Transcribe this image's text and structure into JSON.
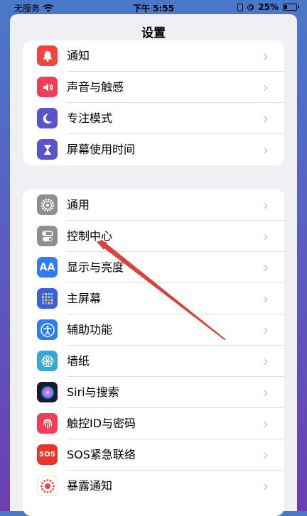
{
  "statusbar": {
    "carrier": "无服务",
    "time": "下午 5:55",
    "battery": "25%",
    "battery_level": 0.25
  },
  "page": {
    "title": "设置"
  },
  "group1": [
    {
      "label": "通知",
      "icon": "notification-bell-icon",
      "color": "#f0443f"
    },
    {
      "label": "声音与触感",
      "icon": "speaker-icon",
      "color": "#f03e5a"
    },
    {
      "label": "专注模式",
      "icon": "moon-icon",
      "color": "#5a54c9"
    },
    {
      "label": "屏幕使用时间",
      "icon": "hourglass-icon",
      "color": "#5a54c9"
    }
  ],
  "group2": [
    {
      "label": "通用",
      "icon": "gear-icon",
      "color": "#8e8e93"
    },
    {
      "label": "控制中心",
      "icon": "toggle-switches-icon",
      "color": "#8e8e93"
    },
    {
      "label": "显示与亮度",
      "icon": "aa-text-icon",
      "color": "#2f7cf6"
    },
    {
      "label": "主屏幕",
      "icon": "app-grid-icon",
      "color": "#3a5fd8"
    },
    {
      "label": "辅助功能",
      "icon": "accessibility-icon",
      "color": "#2f7cf6"
    },
    {
      "label": "墙纸",
      "icon": "flower-icon",
      "color": "#37a7d6"
    },
    {
      "label": "Siri与搜索",
      "icon": "siri-icon",
      "color": "#1a1a2e"
    },
    {
      "label": "触控ID与密码",
      "icon": "fingerprint-icon",
      "color": "#f03e5a"
    },
    {
      "label": "SOS紧急联络",
      "icon": "sos-icon",
      "color": "#e8362f"
    },
    {
      "label": "暴露通知",
      "icon": "exposure-dots-icon",
      "color": "#ffffff"
    }
  ],
  "icon_text": {
    "display": "AA",
    "sos": "SOS"
  }
}
